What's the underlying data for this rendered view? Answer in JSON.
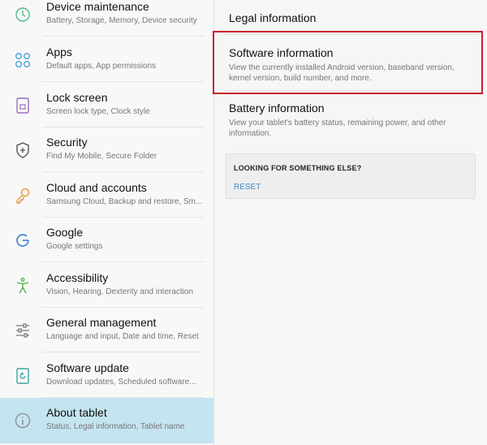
{
  "sidebar": {
    "items": [
      {
        "label": "Device maintenance",
        "sub": "Battery, Storage, Memory, Device security",
        "icon": "device-maintenance-icon"
      },
      {
        "label": "Apps",
        "sub": "Default apps, App permissions",
        "icon": "apps-grid-icon"
      },
      {
        "label": "Lock screen",
        "sub": "Screen lock type, Clock style",
        "icon": "lock-screen-icon"
      },
      {
        "label": "Security",
        "sub": "Find My Mobile, Secure Folder",
        "icon": "shield-icon"
      },
      {
        "label": "Cloud and accounts",
        "sub": "Samsung Cloud, Backup and restore, Sm...",
        "icon": "key-icon"
      },
      {
        "label": "Google",
        "sub": "Google settings",
        "icon": "google-icon"
      },
      {
        "label": "Accessibility",
        "sub": "Vision, Hearing, Dexterity and interaction",
        "icon": "accessibility-icon"
      },
      {
        "label": "General management",
        "sub": "Language and input, Date and time, Reset",
        "icon": "sliders-icon"
      },
      {
        "label": "Software update",
        "sub": "Download updates, Scheduled software...",
        "icon": "software-update-icon"
      },
      {
        "label": "About tablet",
        "sub": "Status, Legal information, Tablet name",
        "icon": "info-icon"
      }
    ]
  },
  "detail": {
    "legal": {
      "title": "Legal information"
    },
    "software": {
      "title": "Software information",
      "desc": "View the currently installed Android version, baseband version, kernel version, build number, and more."
    },
    "battery": {
      "title": "Battery information",
      "desc": "View your tablet's battery status, remaining power, and other information."
    },
    "suggest": {
      "title": "LOOKING FOR SOMETHING ELSE?",
      "reset": "RESET"
    }
  },
  "colors": {
    "active_bg": "#c4e4f0",
    "highlight_border": "#c8232c",
    "link": "#3d8cc4"
  }
}
